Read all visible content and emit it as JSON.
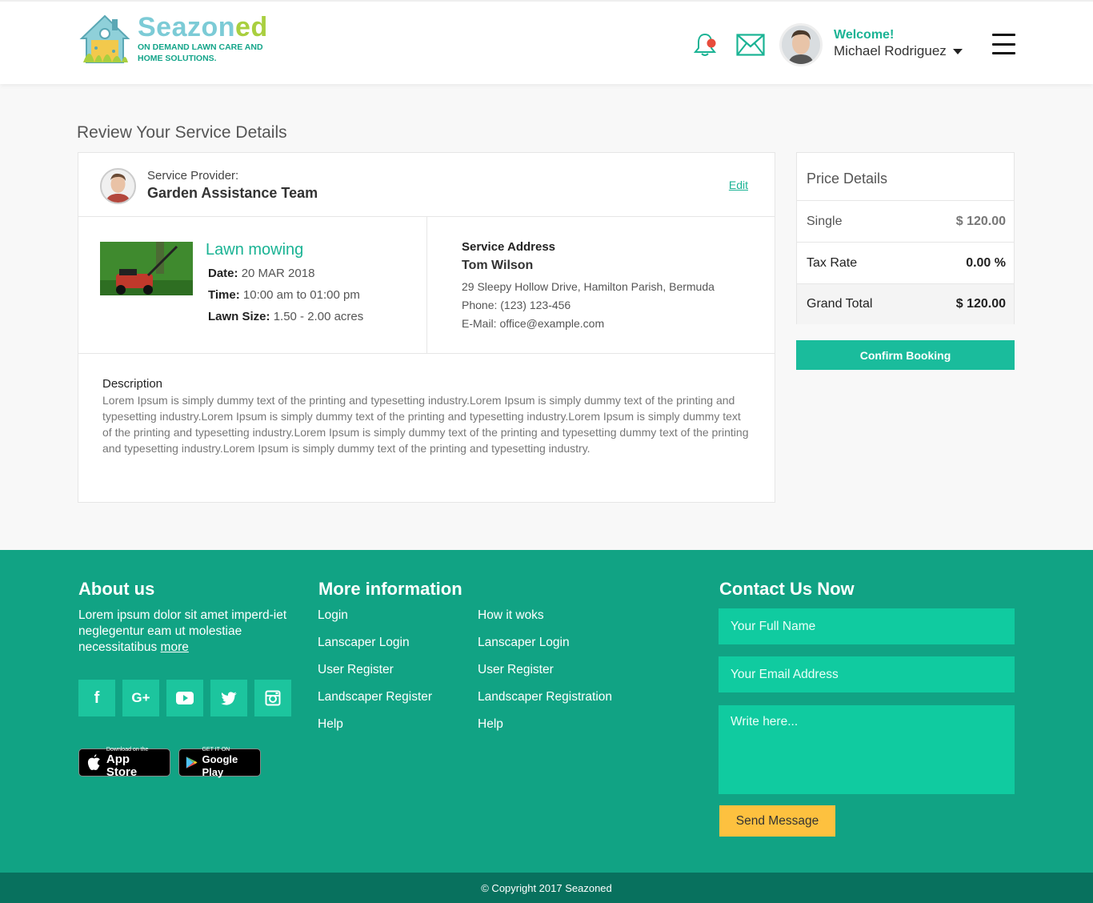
{
  "brand": {
    "name_part1": "Seazon",
    "name_part2": "ed",
    "tagline": "ON DEMAND LAWN CARE AND HOME SOLUTIONS."
  },
  "header": {
    "welcome_label": "Welcome!",
    "user_name": "Michael Rodriguez",
    "notification_dot_color": "#e74c3c"
  },
  "page": {
    "title": "Review Your Service Details"
  },
  "provider": {
    "label": "Service Provider:",
    "name": "Garden Assistance Team",
    "edit_label": "Edit"
  },
  "service": {
    "name": "Lawn mowing",
    "date_label": "Date:",
    "date_value": "20 MAR 2018",
    "time_label": "Time:",
    "time_value": "10:00 am to 01:00 pm",
    "size_label": "Lawn Size:",
    "size_value": "1.50 - 2.00 acres"
  },
  "address": {
    "title": "Service Address",
    "name": "Tom Wilson",
    "street": "29 Sleepy Hollow Drive, Hamilton Parish, Bermuda",
    "phone": "Phone: (123) 123-456",
    "email": "E-Mail: office@example.com"
  },
  "description": {
    "title": "Description",
    "text": "Lorem Ipsum is simply dummy text of the printing and typesetting industry.Lorem Ipsum is simply dummy text of the printing and typesetting industry.Lorem Ipsum is simply dummy text of the printing and typesetting industry.Lorem Ipsum is simply dummy text of the printing and typesetting industry.Lorem Ipsum is simply dummy text of the printing and typesetting dummy text of the printing and typesetting industry.Lorem Ipsum is simply dummy text of the printing and typesetting industry."
  },
  "price": {
    "title": "Price Details",
    "single_label": "Single",
    "single_value": "$ 120.00",
    "tax_label": "Tax Rate",
    "tax_value": "0.00 %",
    "total_label": "Grand Total",
    "total_value": "$ 120.00",
    "confirm_label": "Confirm Booking"
  },
  "footer": {
    "about_title": "About us",
    "about_text": "Lorem ipsum dolor sit amet imperd-iet neglegentur eam ut molestiae necessitatibus",
    "about_more": "more",
    "more_title": "More information",
    "links_col1": [
      "Login",
      "Lanscaper Login",
      "User Register",
      "Landscaper Register",
      "Help"
    ],
    "links_col2": [
      "How it woks",
      "Lanscaper Login",
      "User Register",
      "Landscaper Registration",
      "Help"
    ],
    "appstore_small": "Download on the",
    "appstore_big": "App Store",
    "googleplay_small": "GET IT ON",
    "googleplay_big": "Google Play",
    "contact_title": "Contact Us Now",
    "name_placeholder": "Your Full Name",
    "email_placeholder": "Your Email Address",
    "message_placeholder": "Write here...",
    "send_label": "Send Message",
    "copyright": "© Copyright 2017 Seazoned"
  },
  "social_icons": [
    "facebook-icon",
    "google-plus-icon",
    "youtube-icon",
    "twitter-icon",
    "instagram-icon"
  ],
  "colors": {
    "accent": "#1ab394",
    "footer_bg": "#11a384",
    "copyright_bg": "#08715e",
    "send_button": "#fdc13f"
  }
}
